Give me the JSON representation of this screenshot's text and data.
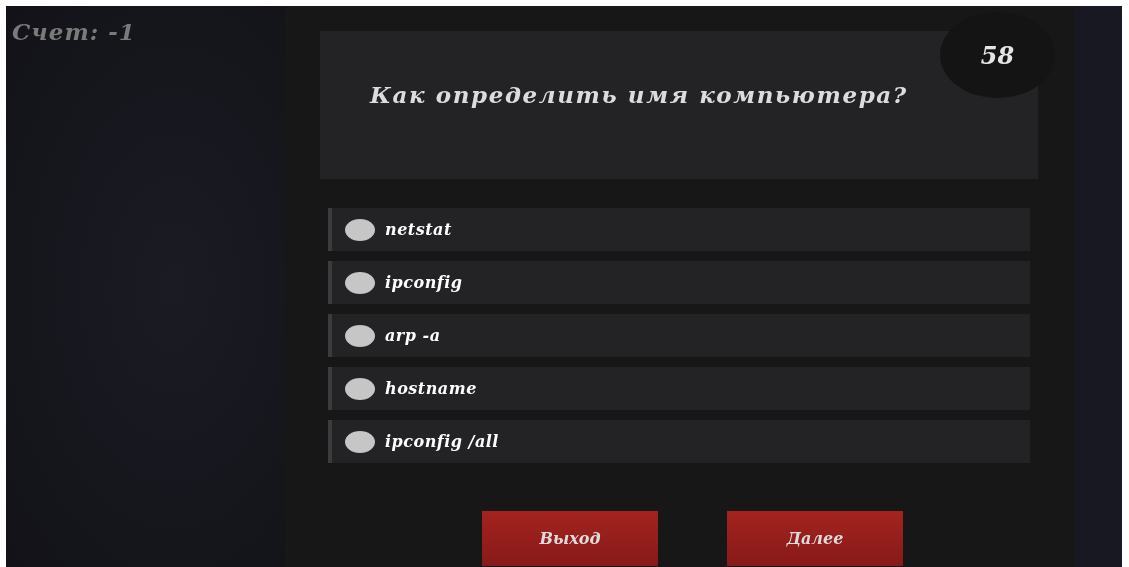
{
  "score": "Счет: -1",
  "question": {
    "text": "Как определить имя компьютера?",
    "timer": "58"
  },
  "options": [
    {
      "label": "netstat",
      "selected": false
    },
    {
      "label": "ipconfig",
      "selected": false
    },
    {
      "label": "arp -a",
      "selected": false
    },
    {
      "label": "hostname",
      "selected": false
    },
    {
      "label": "ipconfig /all",
      "selected": false
    }
  ],
  "buttons": [
    "Выход",
    "Далее"
  ]
}
